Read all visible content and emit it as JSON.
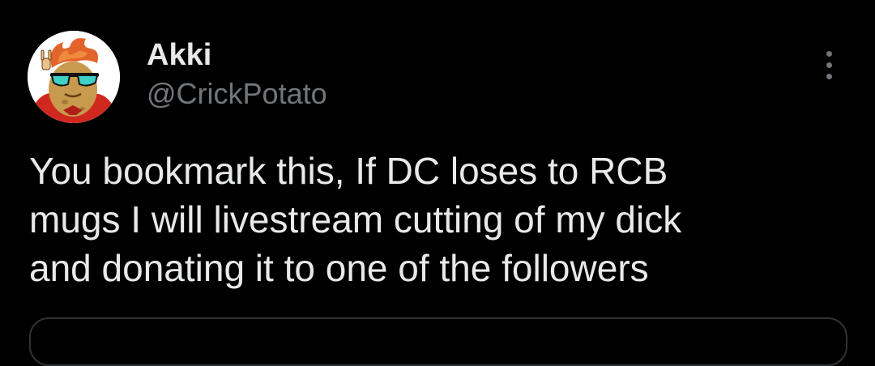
{
  "tweet": {
    "display_name": "Akki",
    "handle": "@CrickPotato",
    "text": "You bookmark this, If DC loses to RCB\nmugs I will livestream cutting of my dick\nand donating it to one of the followers",
    "more_icon": "more-vertical-icon",
    "avatar_icon": "potato-cartoon-avatar"
  },
  "colors": {
    "background": "#000000",
    "primary_text": "#e7e9ea",
    "secondary_text": "#71767b",
    "border": "#2f3336"
  }
}
